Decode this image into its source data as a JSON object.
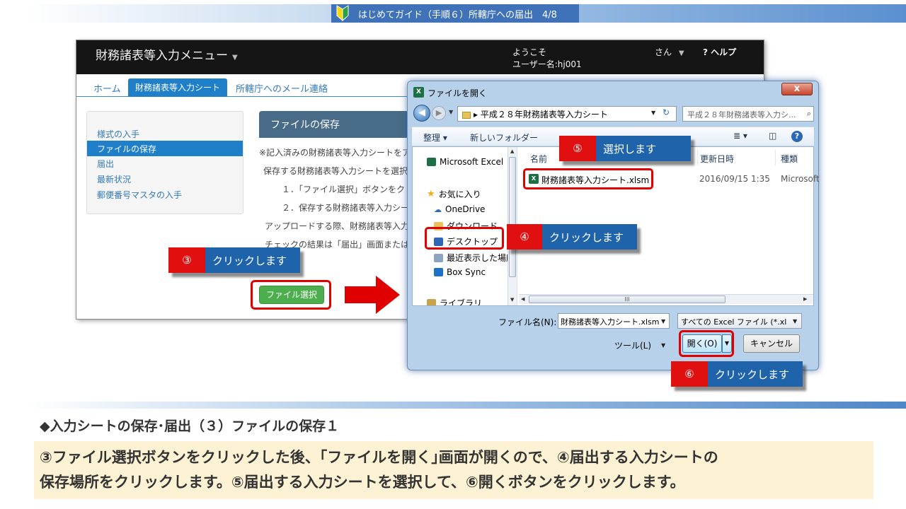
{
  "banner": {
    "title": "はじめてガイド（手順６）所轄庁への届出　4/8",
    "colors": {
      "band": "#3f72b8",
      "text": "#ffffff"
    }
  },
  "app": {
    "title": "財務諸表等入力メニュー",
    "welcome": "ようこそ",
    "username": "ユーザー名:hj001",
    "san": "さん",
    "help": "? ヘルプ",
    "tabs": [
      {
        "label": "ホーム",
        "active": false
      },
      {
        "label": "財務諸表等入力シート",
        "active": true
      },
      {
        "label": "所轄庁へのメール連絡",
        "active": false
      }
    ],
    "sidebar": [
      {
        "label": "様式の入手",
        "active": false
      },
      {
        "label": "ファイルの保存",
        "active": true
      },
      {
        "label": "届出",
        "active": false
      },
      {
        "label": "最新状況",
        "active": false
      },
      {
        "label": "郵便番号マスタの入手",
        "active": false
      }
    ],
    "panel_title": "ファイルの保存",
    "body_lines": [
      "※記入済みの財務諸表等入力シートをア",
      "保存する財務諸表等入力シートを選択",
      "１．「ファイル選択」ボタンをク",
      "２．保存する財務諸表等入力シー",
      "アップロードする際、財務諸表等入力",
      "チェックの結果は「届出」画面または"
    ],
    "file_select_button": "ファイル選択",
    "accent_color": "#1f7fc8"
  },
  "dialog": {
    "title": "ファイルを開く",
    "close": "x",
    "address": "平成２８年財務諸表等入力シート",
    "search_placeholder": "平成２８年財務諸表等入力シ...",
    "toolbar": {
      "organize": "整理 ▾",
      "new_folder": "新しいフォルダー",
      "view_icon": "≣ ▾"
    },
    "nav_items": [
      {
        "label": "Microsoft Excel",
        "icon": "excel-icon"
      },
      {
        "label": "お気に入り",
        "icon": "star-icon"
      },
      {
        "label": "OneDrive",
        "icon": "cloud-icon"
      },
      {
        "label": "ダウンロード",
        "icon": "download-folder-icon"
      },
      {
        "label": "デスクトップ",
        "icon": "desktop-icon"
      },
      {
        "label": "最近表示した場所",
        "icon": "recent-icon"
      },
      {
        "label": "Box Sync",
        "icon": "box-icon"
      },
      {
        "label": "ライブラリ",
        "icon": "library-icon"
      }
    ],
    "columns": {
      "name": "名前",
      "modified": "更新日時",
      "type": "種類"
    },
    "files": [
      {
        "name": "財務諸表等入力シート.xlsm",
        "modified": "2016/09/15 1:35",
        "type": "Microsoft"
      }
    ],
    "hscroll_label": "III",
    "filename_label": "ファイル名(N):",
    "filename_value": "財務諸表等入力シート.xlsm",
    "filter": "すべての Excel ファイル (*.xl",
    "tools": "ツール(L)",
    "open": "開く(O)",
    "cancel": "キャンセル"
  },
  "callouts": [
    {
      "num": "③",
      "text": "クリックします"
    },
    {
      "num": "④",
      "text": "クリックします"
    },
    {
      "num": "⑤",
      "text": "選択します"
    },
    {
      "num": "⑥",
      "text": "クリックします"
    }
  ],
  "callout_colors": {
    "number": "#e01010",
    "label": "#1f64ab"
  },
  "heading": "◆入力シートの保存･届出（３）ファイルの保存１",
  "description": [
    "③ファイル選択ボタンをクリックした後、｢ファイルを開く｣画面が開くので、④届出する入力シートの",
    "保存場所をクリックします。⑤届出する入力シートを選択して、⑥開くボタンをクリックします。"
  ]
}
